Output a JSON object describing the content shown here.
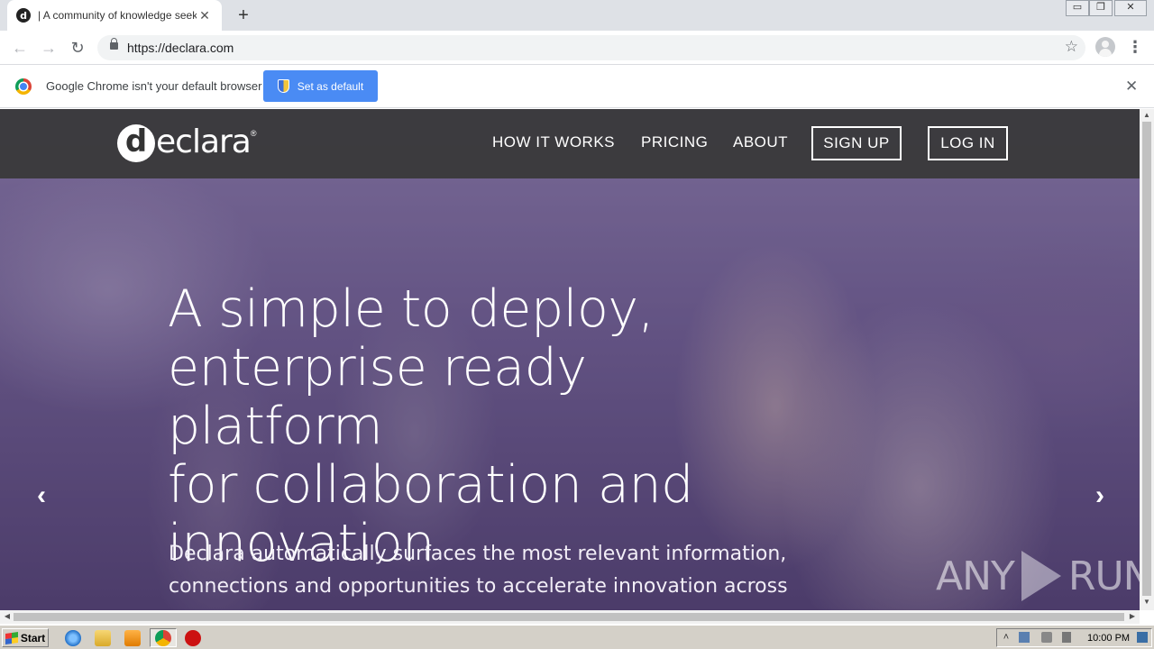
{
  "browser": {
    "tab_favicon": "d",
    "tab_title": "| A community of knowledge seekers",
    "tab_close": "✕",
    "new_tab": "+",
    "url": "https://declara.com",
    "window_controls": {
      "minimize": "▭",
      "restore": "❐",
      "close": "✕"
    },
    "icons": {
      "back": "←",
      "forward": "→",
      "reload": "↻",
      "star": "☆",
      "menu": "⋮"
    }
  },
  "infobar": {
    "message": "Google Chrome isn't your default browser",
    "button_label": "Set as default",
    "close": "✕"
  },
  "site": {
    "logo_mark": "d",
    "logo_text": "eclara",
    "logo_reg": "®",
    "nav": {
      "how_it_works": "HOW IT WORKS",
      "pricing": "PRICING",
      "about": "ABOUT",
      "sign_up": "SIGN UP",
      "log_in": "LOG IN"
    },
    "hero": {
      "headline_lines": [
        "A simple to deploy,",
        "enterprise ready platform",
        "for collaboration and",
        "innovation"
      ],
      "subtext_lines": [
        "Declara automatically surfaces the most relevant information,",
        "connections and opportunities to accelerate innovation across"
      ],
      "prev_arrow": "‹",
      "next_arrow": "›"
    },
    "watermark": {
      "left": "ANY",
      "right": "RUN"
    }
  },
  "scrollbars": {
    "up": "▲",
    "down": "▼",
    "left": "◀",
    "right": "▶"
  },
  "taskbar": {
    "start_label": "Start",
    "clock": "10:00 PM",
    "tray_up": "˄"
  }
}
